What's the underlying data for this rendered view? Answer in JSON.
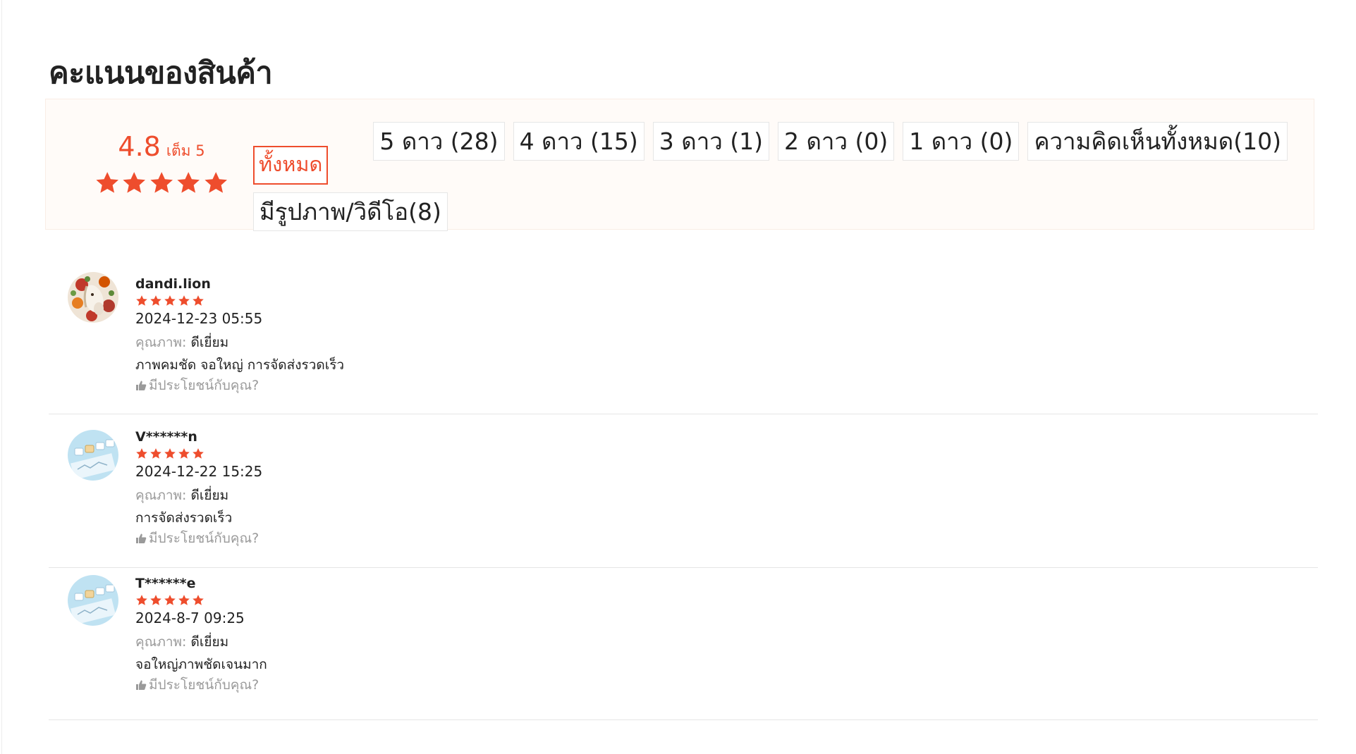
{
  "section": {
    "title": "คะแนนของสินค้า"
  },
  "summary": {
    "score": "4.8",
    "out_of": "เต็ม 5",
    "score_stars": 5,
    "filters": [
      {
        "label": "ทั้งหมด",
        "active": true
      },
      {
        "label": "5 ดาว (28)",
        "active": false
      },
      {
        "label": "4 ดาว (15)",
        "active": false
      },
      {
        "label": "3 ดาว (1)",
        "active": false
      },
      {
        "label": "2 ดาว (0)",
        "active": false
      },
      {
        "label": "1 ดาว (0)",
        "active": false
      },
      {
        "label": "ความคิดเห็นทั้งหมด(10)",
        "active": false
      },
      {
        "label": "มีรูปภาพ/วิดีโอ(8)",
        "active": false
      }
    ]
  },
  "reviews": [
    {
      "name": "dandi.lion",
      "stars": 5,
      "date": "2024-12-23 05:55",
      "quality_label": "คุณภาพ:",
      "quality_value": "ดีเยี่ยม",
      "text": "ภาพคมชัด จอใหญ่ การจัดส่งรวดเร็ว",
      "helpful": "มีประโยชน์กับคุณ?",
      "avatar_icon": "horse-floral-avatar-icon"
    },
    {
      "name": "V******n",
      "stars": 5,
      "date": "2024-12-22 15:25",
      "quality_label": "คุณภาพ:",
      "quality_value": "ดีเยี่ยม",
      "text": "การจัดส่งรวดเร็ว",
      "helpful": "มีประโยชน์กับคุณ?",
      "avatar_icon": "keyboard-avatar-icon"
    },
    {
      "name": "T******e",
      "stars": 5,
      "date": "2024-8-7 09:25",
      "quality_label": "คุณภาพ:",
      "quality_value": "ดีเยี่ยม",
      "text": "จอใหญ่ภาพชัดเจนมาก",
      "helpful": "มีประโยชน์กับคุณ?",
      "avatar_icon": "keyboard-avatar-icon"
    }
  ],
  "colors": {
    "accent": "#ee4d2d",
    "summary_bg": "#fffbf8",
    "muted_text": "#9a9a9a"
  }
}
